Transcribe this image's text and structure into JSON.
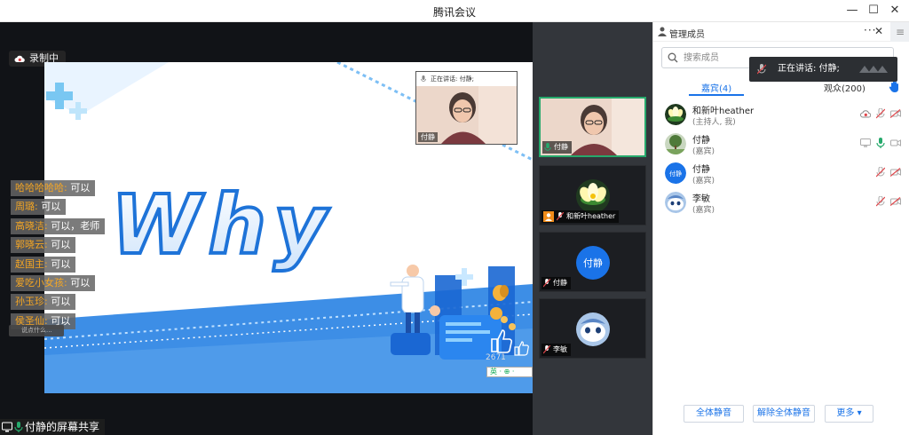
{
  "window": {
    "title": "腾讯会议",
    "minimize": "—",
    "maximize": "☐",
    "close": "✕"
  },
  "stage": {
    "recording_label": "录制中",
    "slide_word": "Why",
    "pip": {
      "header": "正在讲话: 付静;",
      "name": "付静"
    },
    "like_count": "2671",
    "ime_text": "英 · ⊕ ·",
    "share_label": "付静的屏幕共享"
  },
  "chat": {
    "messages": [
      {
        "who": "哈哈哈哈哈:",
        "text": "可以"
      },
      {
        "who": "周璐:",
        "text": "可以"
      },
      {
        "who": "高晓洁:",
        "text": "可以，老师"
      },
      {
        "who": "郭晓云:",
        "text": "可以"
      },
      {
        "who": "赵国主:",
        "text": "可以"
      },
      {
        "who": "爱吃小女孩:",
        "text": "可以"
      },
      {
        "who": "孙玉珍:",
        "text": "可以"
      },
      {
        "who": "侯圣仙:",
        "text": "可以"
      }
    ],
    "input_tip": "说点什么..."
  },
  "strip": {
    "tiles": [
      {
        "name": "付静"
      },
      {
        "name": "和新叶heather"
      },
      {
        "name": "付静",
        "avatar_text": "付静"
      },
      {
        "name": "李敏"
      }
    ]
  },
  "panel": {
    "title": "管理成员",
    "more": "···",
    "close": "✕",
    "side_toggle": "≡",
    "search_placeholder": "搜索成员",
    "speaking_label": "正在讲话: 付静;",
    "tabs": {
      "guests": "嘉宾(4)",
      "audience": "观众(200)"
    },
    "members": [
      {
        "name": "和新叶heather",
        "role": "(主持人, 我)"
      },
      {
        "name": "付静",
        "role": "(嘉宾)"
      },
      {
        "name": "付静",
        "role": "(嘉宾)",
        "avatar_text": "付静"
      },
      {
        "name": "李敏",
        "role": "(嘉宾)"
      }
    ],
    "buttons": {
      "mute_all": "全体静音",
      "unmute_all": "解除全体静音",
      "more": "更多 ▾"
    }
  },
  "colors": {
    "accent": "#1a73e8",
    "active_border": "#26a96c",
    "mic_green": "#26a96c",
    "muted_red": "#e0464b",
    "chat_name": "#f5a623"
  }
}
